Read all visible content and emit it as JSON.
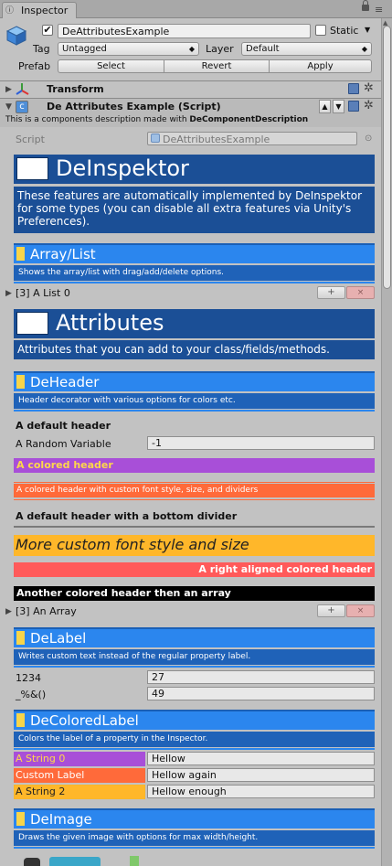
{
  "window": {
    "tab_title": "Inspector",
    "tab_glyph": "ⓘ",
    "menu_glyph": "≡"
  },
  "header": {
    "object_name": "DeAttributesExample",
    "active_check": "✔",
    "static_label": "Static",
    "tag_label": "Tag",
    "tag_value": "Untagged",
    "layer_label": "Layer",
    "layer_value": "Default",
    "prefab_label": "Prefab",
    "select_btn": "Select",
    "revert_btn": "Revert",
    "apply_btn": "Apply"
  },
  "glyphs": {
    "fold_right": "▶",
    "fold_down": "▼",
    "up": "▲",
    "down": "▼",
    "drop": "▼",
    "gear": "✲",
    "file": "c",
    "small_up": "▲"
  },
  "transform": {
    "label": "Transform"
  },
  "script_component": {
    "title": "De Attributes Example (Script)",
    "desc_prefix": "This is a components description made with ",
    "desc_bold": "DeComponentDescription",
    "script_label": "Script",
    "script_value": "DeAttributesExample",
    "picker_glyph": "⊙"
  },
  "deinspektor": {
    "title": "DeInspektor",
    "desc": "These features are automatically implemented by DeInspektor for some types (you can disable all extra features via Unity's Preferences)."
  },
  "array_list": {
    "title": "Array/List",
    "desc": "Shows the array/list with drag/add/delete options.",
    "row_label": "[3] A List 0",
    "add": "+",
    "del": "×"
  },
  "attributes": {
    "title": "Attributes",
    "desc": "Attributes that you can add to your class/fields/methods."
  },
  "deheader": {
    "title": "DeHeader",
    "desc": "Header decorator with various options for colors etc.",
    "default_header": "A default header",
    "random_label": "A Random Variable",
    "random_value": "-1",
    "colored_header": "A colored header",
    "custom_style_header": "A colored header with custom font style, size, and dividers",
    "bottom_divider_header": "A default header with a bottom divider",
    "custom_font_header": "More custom font style and size",
    "right_aligned_header": "A right aligned colored header",
    "array_header": "Another colored header then an array",
    "array_row": "[3] An Array",
    "add": "+",
    "del": "×"
  },
  "delabel": {
    "title": "DeLabel",
    "desc": "Writes custom text instead of the regular property label.",
    "rows": [
      {
        "label": "1234",
        "value": "27"
      },
      {
        "label": "_%&()",
        "value": "49"
      }
    ]
  },
  "decoloredlabel": {
    "title": "DeColoredLabel",
    "desc": "Colors the label of a property in the Inspector.",
    "rows": [
      {
        "label": "A String 0",
        "value": "Hellow",
        "color": "#a84fd8"
      },
      {
        "label": "Custom Label",
        "value": "Hellow again",
        "color": "#ff6a3a"
      },
      {
        "label": "A String 2",
        "value": "Hellow enough",
        "color": "#ffb72a"
      }
    ]
  },
  "deimage": {
    "title": "DeImage",
    "desc": "Draws the given image with options for max width/height."
  },
  "colors": {
    "dark_blue": "#1b4f96",
    "light_blue": "#2b86ee",
    "purple": "#a84fd8",
    "orange": "#ff6a3a",
    "yellow": "#ffb72a",
    "red": "#ff5a5a",
    "black": "#000000"
  }
}
